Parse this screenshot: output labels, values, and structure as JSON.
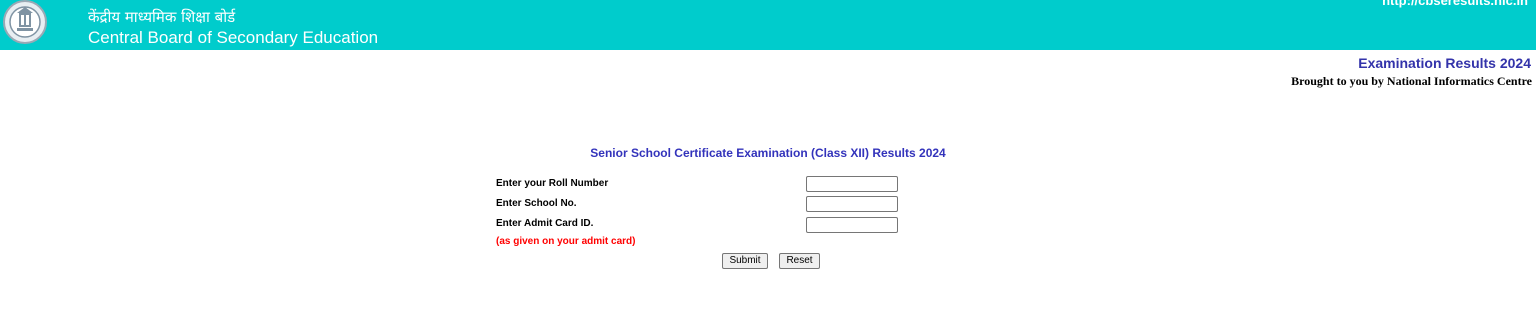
{
  "header": {
    "title_hindi": "केंद्रीय माध्यमिक शिक्षा बोर्ड",
    "title_english": "Central Board of Secondary Education",
    "site_url": "http://cbseresults.nic.in",
    "background_color": "#00cccc"
  },
  "subheader": {
    "exam_results": "Examination Results 2024",
    "brought_by": "Brought to you by National Informatics Centre"
  },
  "form": {
    "heading": "Senior School Certificate Examination (Class XII) Results 2024",
    "roll_label": "Enter your Roll Number",
    "roll_value": "",
    "school_label": "Enter School No.",
    "school_value": "",
    "admit_label": "Enter Admit Card ID.",
    "admit_value": "",
    "admit_note": "(as given on your admit card)",
    "submit_label": "Submit",
    "reset_label": "Reset"
  }
}
